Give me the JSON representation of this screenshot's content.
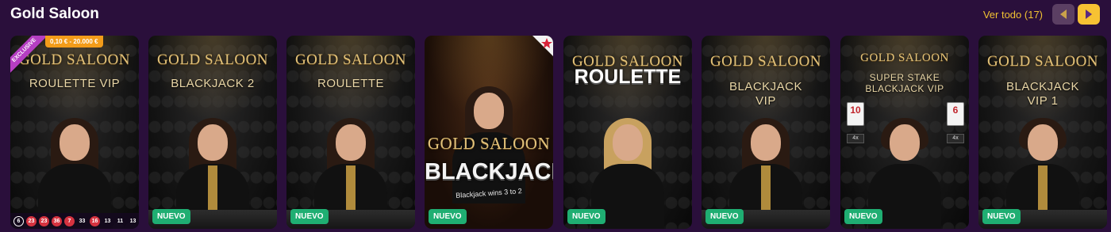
{
  "header": {
    "title": "Gold Saloon",
    "view_all": "Ver todo (17)"
  },
  "colors": {
    "page_bg": "#2a0f3b",
    "accent": "#f7c233",
    "new_badge": "#1fae72",
    "exclusive": "#b53ec2",
    "limits": "#f39c1a"
  },
  "cards": [
    {
      "brand": "GOLD SALOON",
      "subtitle": "ROULETTE VIP",
      "exclusive": "EXCLUSIVE",
      "limits": "0,10 € - 20.000 €",
      "results": [
        "6",
        "23",
        "23",
        "36",
        "7",
        "33",
        "16",
        "13",
        "11",
        "13"
      ]
    },
    {
      "brand": "GOLD SALOON",
      "subtitle": "BLACKJACK 2",
      "badge": "NUEVO"
    },
    {
      "brand": "GOLD SALOON",
      "subtitle": "ROULETTE",
      "badge": "NUEVO"
    },
    {
      "brand": "GOLD SALOON",
      "subtitle": "BLACKJACK",
      "note": "Blackjack wins 3 to 2",
      "badge": "NUEVO"
    },
    {
      "brand": "GOLD SALOON",
      "subtitle": "ROULETTE",
      "badge": "NUEVO"
    },
    {
      "brand": "GOLD SALOON",
      "subtitle": "BLACKJACK VIP",
      "badge": "NUEVO"
    },
    {
      "brand": "GOLD SALOON",
      "subtitle": "SUPER STAKE BLACKJACK VIP",
      "badge": "NUEVO",
      "cards_shown": [
        "10",
        "6"
      ],
      "multipliers": [
        "4x",
        "4x"
      ]
    },
    {
      "brand": "GOLD SALOON",
      "subtitle": "BLACKJACK VIP 1",
      "badge": "NUEVO"
    }
  ]
}
